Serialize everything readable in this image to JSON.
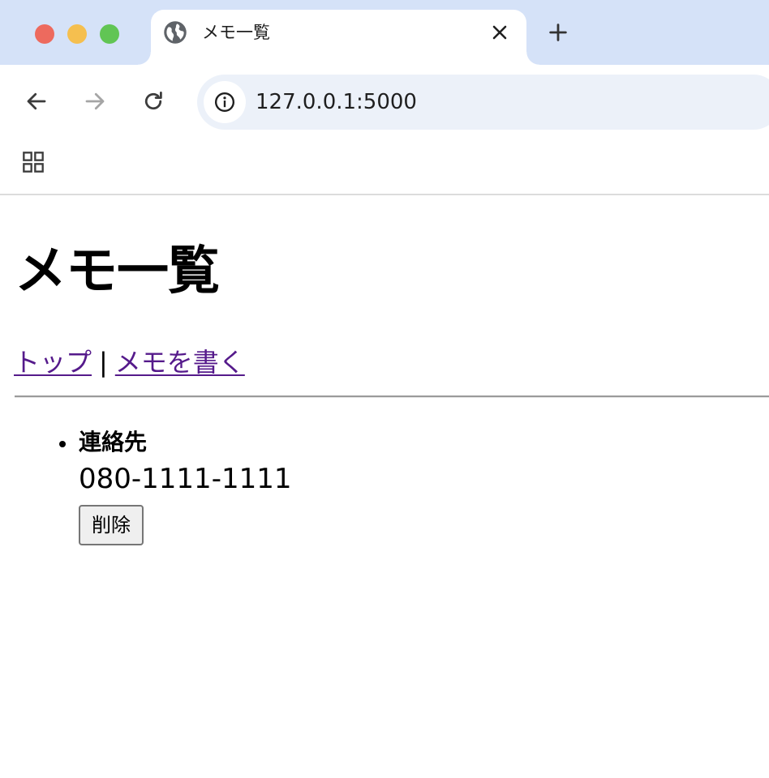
{
  "browser": {
    "tab": {
      "title": "メモ一覧"
    },
    "address_bar": {
      "url": "127.0.0.1:5000"
    },
    "icons": {
      "favicon": "globe-icon",
      "tab_close": "close-icon",
      "new_tab": "plus-icon",
      "back": "arrow-left-icon",
      "forward": "arrow-right-icon",
      "reload": "reload-icon",
      "site_info": "info-icon",
      "apps": "apps-grid-icon"
    }
  },
  "page": {
    "title": "メモ一覧",
    "nav": {
      "top_link": "トップ",
      "separator": "|",
      "write_link": "メモを書く"
    },
    "memos": [
      {
        "title": "連絡先",
        "body": "080-1111-1111",
        "delete_label": "削除"
      }
    ]
  },
  "colors": {
    "tabbar_bg": "#d5e2f8",
    "omnibox_bg": "#ecf1f9",
    "visited_link": "#551a8b",
    "traffic_close": "#ed6a5e",
    "traffic_minimize": "#f5bf4f",
    "traffic_maximize": "#61c554"
  }
}
